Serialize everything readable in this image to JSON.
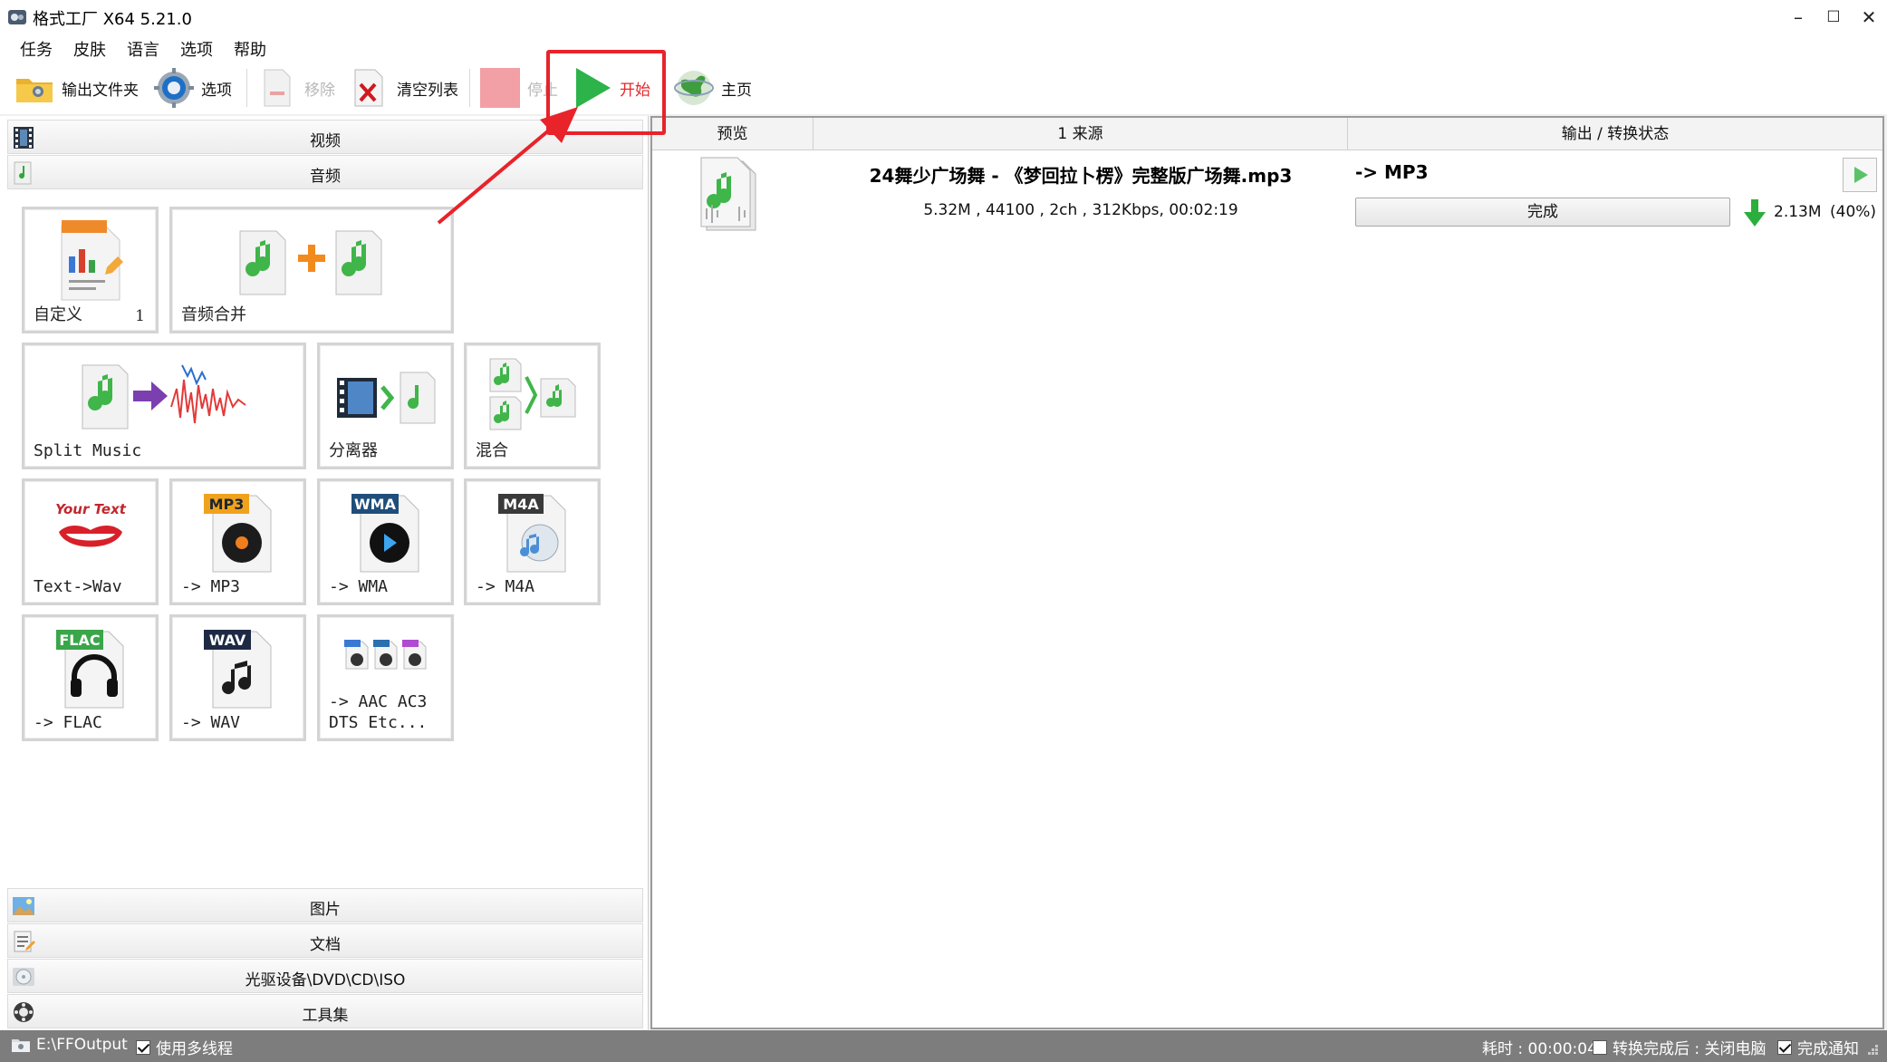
{
  "window": {
    "title": "格式工厂 X64 5.21.0",
    "minimize": "–",
    "maximize": "☐",
    "close": "✕"
  },
  "menu": [
    "任务",
    "皮肤",
    "语言",
    "选项",
    "帮助"
  ],
  "toolbar": {
    "output_folder": "输出文件夹",
    "options": "选项",
    "remove": "移除",
    "clear_list": "清空列表",
    "stop": "停止",
    "start": "开始",
    "home": "主页"
  },
  "categories": {
    "video": "视频",
    "audio": "音频",
    "picture": "图片",
    "document": "文档",
    "rom": "光驱设备\\DVD\\CD\\ISO",
    "tools": "工具集"
  },
  "tiles": {
    "custom": {
      "label": "自定义",
      "count": "1"
    },
    "merge": {
      "label": "音频合并"
    },
    "split": {
      "label": "Split Music"
    },
    "splitter": {
      "label": "分离器"
    },
    "mix": {
      "label": "混合"
    },
    "text_wav": {
      "label": "Text->Wav",
      "badge": "Your Text"
    },
    "mp3": {
      "label": "-> MP3",
      "badge": "MP3"
    },
    "wma": {
      "label": "-> WMA",
      "badge": "WMA"
    },
    "m4a": {
      "label": "-> M4A",
      "badge": "M4A"
    },
    "flac": {
      "label": "-> FLAC",
      "badge": "FLAC"
    },
    "wav": {
      "label": "-> WAV",
      "badge": "WAV"
    },
    "aac": {
      "label": "-> AAC AC3\nDTS Etc..."
    }
  },
  "columns": {
    "preview": "预览",
    "source": "1 来源",
    "output": "输出 / 转换状态"
  },
  "task": {
    "filename": "24舞少广场舞 - 《梦回拉卜楞》完整版广场舞.mp3",
    "meta": "5.32M , 44100 , 2ch , 312Kbps, 00:02:19",
    "target": "-> MP3",
    "status": "完成",
    "output_size": "2.13M",
    "ratio": "(40%)"
  },
  "statusbar": {
    "output_path": "E:\\FFOutput",
    "multithread": "使用多线程",
    "elapsed": "耗时 : 00:00:04",
    "after_done": "转换完成后 : 关闭电脑",
    "notify": "完成通知"
  },
  "colors": {
    "highlight": "#e8232a",
    "play_green": "#2cb34a",
    "stop_red": "#f2a0a5",
    "statusbar_bg": "#7d7d7d"
  }
}
